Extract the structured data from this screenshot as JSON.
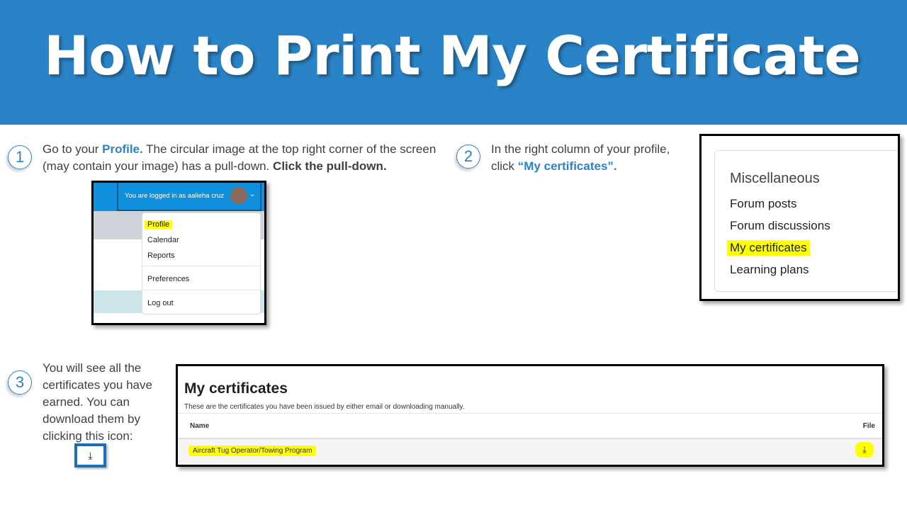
{
  "title": "How to Print My Certificate",
  "steps": [
    {
      "number": "1",
      "text_a": "Go to your ",
      "highlight": "Profile.",
      "text_b": " The circular image at the top right corner of the screen (may contain your image) has a pull-down. ",
      "bold": "Click the pull-down."
    },
    {
      "number": "2",
      "text_a": "In the right column of your profile, click ",
      "highlight": "“My certificates”."
    },
    {
      "number": "3",
      "text": "You will see all the certificates you have earned. You can download them by clicking this icon:"
    }
  ],
  "inset1": {
    "logged_in": "You are logged in as aalieha cruz",
    "menu": [
      "Profile",
      "Calendar",
      "Reports",
      "Preferences",
      "Log out"
    ]
  },
  "inset2": {
    "heading": "Miscellaneous",
    "links": [
      "Forum posts",
      "Forum discussions",
      "My certificates",
      "Learning plans"
    ]
  },
  "inset3": {
    "heading": "My certificates",
    "description": "These are the certificates you have been issued by either email or downloading manually.",
    "columns": [
      "Name",
      "File"
    ],
    "rows": [
      {
        "name": "Aircraft Tug Operator/Towing Program",
        "file_icon": "download-icon"
      }
    ]
  },
  "colors": {
    "banner": "#2a83c6",
    "highlight": "#ffff00",
    "moodle_nav": "#0f8fdc"
  }
}
